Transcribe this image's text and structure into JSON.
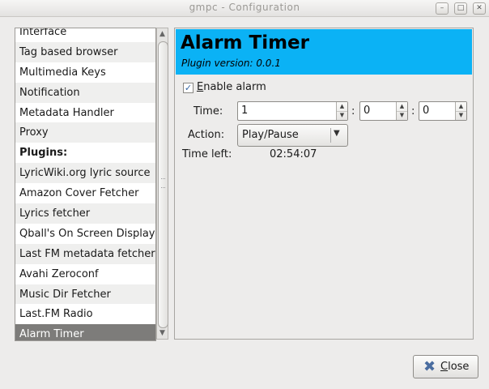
{
  "window": {
    "title": "gmpc - Configuration",
    "controls": {
      "minimize": "–",
      "maximize": "□",
      "close": "✕"
    }
  },
  "sidebar": {
    "items": [
      {
        "label": "Interface",
        "selected": false,
        "bold": false
      },
      {
        "label": "Tag based browser",
        "selected": false,
        "bold": false
      },
      {
        "label": "Multimedia Keys",
        "selected": false,
        "bold": false
      },
      {
        "label": "Notification",
        "selected": false,
        "bold": false
      },
      {
        "label": "Metadata Handler",
        "selected": false,
        "bold": false
      },
      {
        "label": "Proxy",
        "selected": false,
        "bold": false
      },
      {
        "label": "Plugins:",
        "selected": false,
        "bold": true
      },
      {
        "label": "LyricWiki.org lyric source",
        "selected": false,
        "bold": false
      },
      {
        "label": "Amazon Cover Fetcher",
        "selected": false,
        "bold": false
      },
      {
        "label": "Lyrics fetcher",
        "selected": false,
        "bold": false
      },
      {
        "label": "Qball's On Screen Display",
        "selected": false,
        "bold": false
      },
      {
        "label": "Last FM metadata fetcher",
        "selected": false,
        "bold": false
      },
      {
        "label": "Avahi Zeroconf",
        "selected": false,
        "bold": false
      },
      {
        "label": "Music Dir Fetcher",
        "selected": false,
        "bold": false
      },
      {
        "label": "Last.FM Radio",
        "selected": false,
        "bold": false
      },
      {
        "label": "Alarm Timer",
        "selected": true,
        "bold": false
      }
    ]
  },
  "plugin": {
    "title": "Alarm Timer",
    "version": "Plugin version: 0.0.1",
    "banner_color": "#0bb2f5",
    "enable": {
      "mnemonic": "E",
      "label_rest": "nable alarm",
      "checked": true
    },
    "time": {
      "label": "Time:",
      "hours": "1",
      "minutes": "0",
      "seconds": "0",
      "separator": ":"
    },
    "action": {
      "label": "Action:",
      "value": "Play/Pause"
    },
    "time_left": {
      "label": "Time left:",
      "value": "02:54:07"
    }
  },
  "footer": {
    "close_mnemonic": "C",
    "close_label_rest": "lose"
  }
}
